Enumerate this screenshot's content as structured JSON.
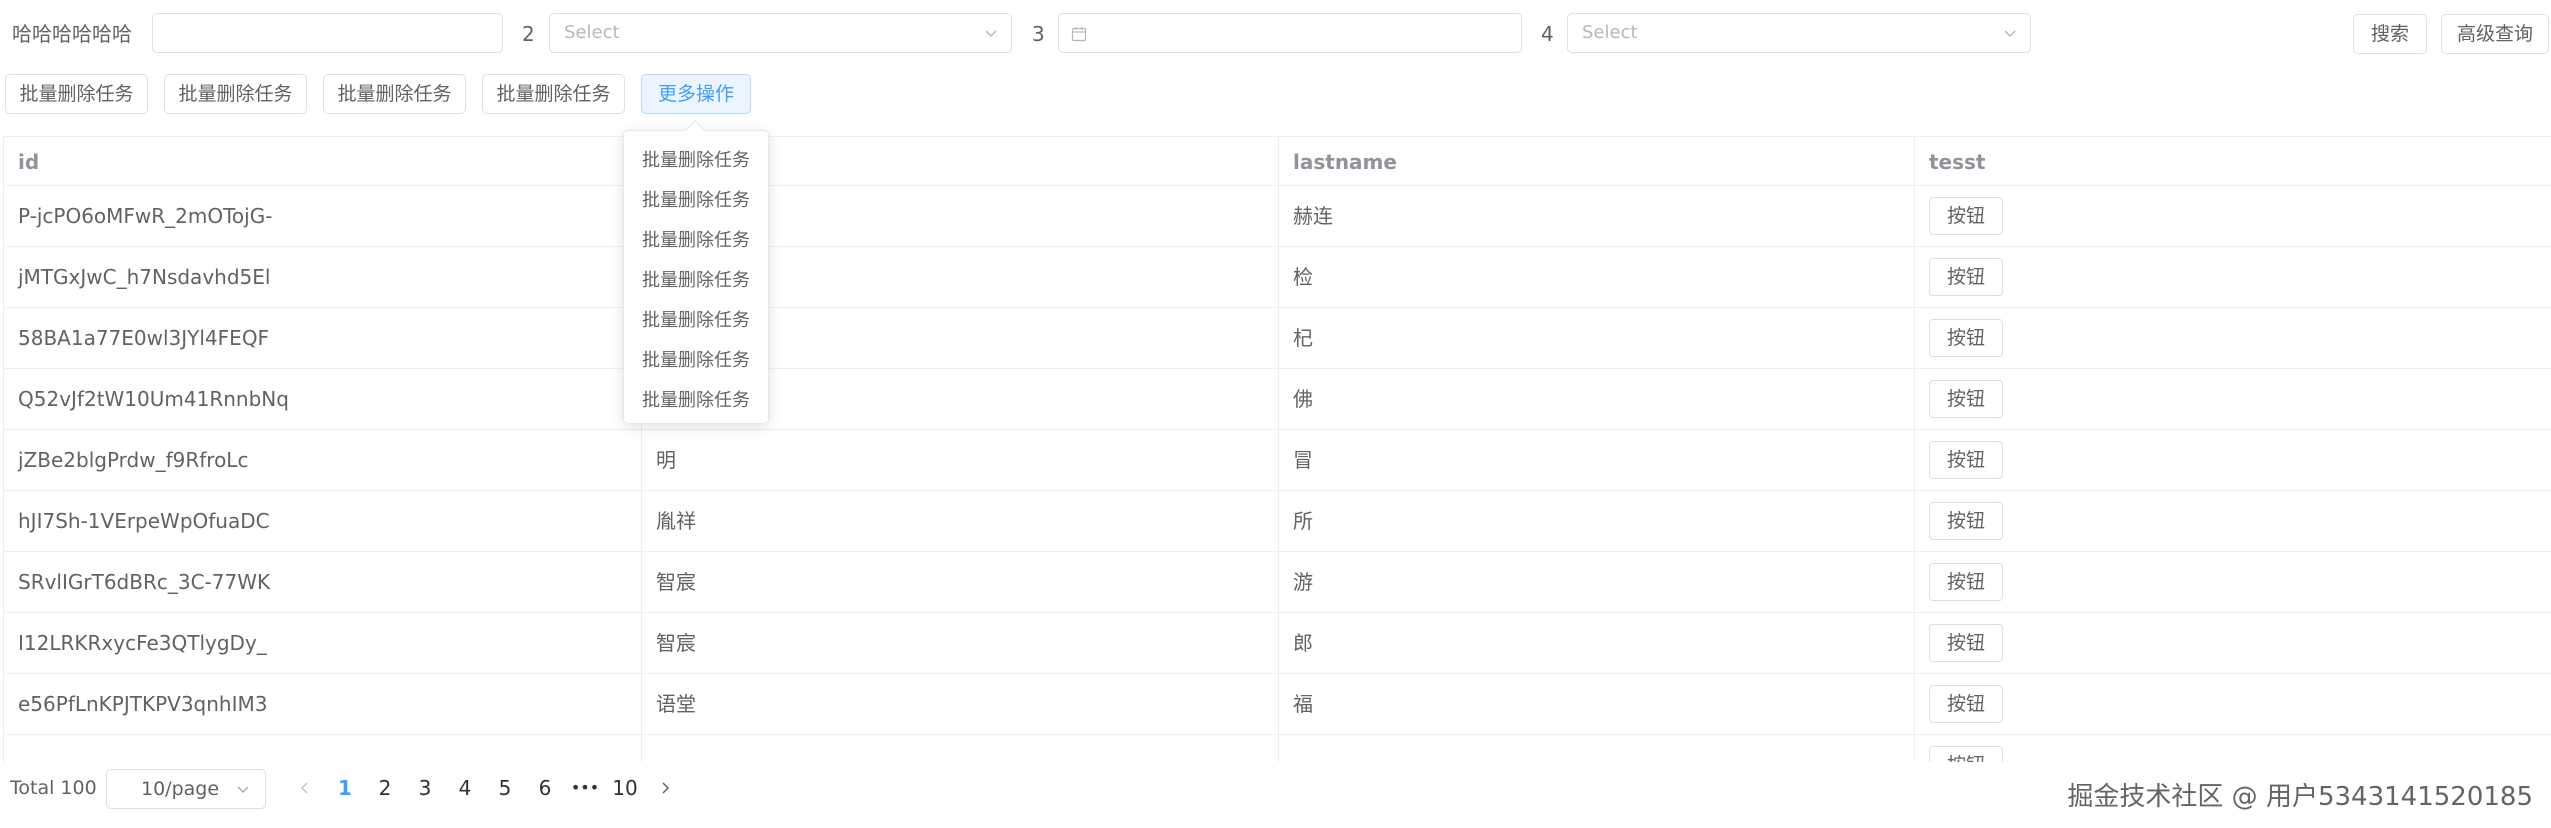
{
  "form": {
    "label1": "哈哈哈哈哈哈",
    "label2": "2",
    "label3": "3",
    "label4": "4",
    "select2_placeholder": "Select",
    "select4_placeholder": "Select",
    "search_button": "搜索",
    "advanced_button": "高级查询"
  },
  "batch": {
    "buttons": [
      "批量删除任务",
      "批量删除任务",
      "批量删除任务",
      "批量删除任务"
    ],
    "more_button": "更多操作"
  },
  "dropdown": {
    "items": [
      "批量删除任务",
      "批量删除任务",
      "批量删除任务",
      "批量删除任务",
      "批量删除任务",
      "批量删除任务",
      "批量删除任务"
    ]
  },
  "table": {
    "columns": [
      "id",
      "",
      "lastname",
      "tesst"
    ],
    "rows": [
      {
        "id": "P-jcPO6oMFwR_2mOTojG-",
        "firstname": "",
        "lastname": "赫连",
        "action": "按钮"
      },
      {
        "id": "jMTGxJwC_h7Nsdavhd5El",
        "firstname": "",
        "lastname": "检",
        "action": "按钮"
      },
      {
        "id": "58BA1a77E0wl3JYl4FEQF",
        "firstname": "",
        "lastname": "杞",
        "action": "按钮"
      },
      {
        "id": "Q52vJf2tW10Um41RnnbNq",
        "firstname": "",
        "lastname": "佛",
        "action": "按钮"
      },
      {
        "id": "jZBe2blgPrdw_f9RfroLc",
        "firstname": "明",
        "lastname": "冒",
        "action": "按钮"
      },
      {
        "id": "hJI7Sh-1VErpeWpOfuaDC",
        "firstname": "胤祥",
        "lastname": "所",
        "action": "按钮"
      },
      {
        "id": "SRvlIGrT6dBRc_3C-77WK",
        "firstname": "智宸",
        "lastname": "游",
        "action": "按钮"
      },
      {
        "id": "I12LRKRxycFe3QTlygDy_",
        "firstname": "智宸",
        "lastname": "郎",
        "action": "按钮"
      },
      {
        "id": "e56PfLnKPJTKPV3qnhIM3",
        "firstname": "语堂",
        "lastname": "福",
        "action": "按钮"
      },
      {
        "id": "",
        "firstname": "",
        "lastname": "",
        "action": "按钮"
      }
    ]
  },
  "pagination": {
    "total": "Total 100",
    "page_size": "10/page",
    "pages": [
      "1",
      "2",
      "3",
      "4",
      "5",
      "6",
      "•••",
      "10"
    ],
    "active_page": "1"
  },
  "watermark": "掘金技术社区 @ 用户5343141520185",
  "colors": {
    "primary": "#409eff",
    "border": "#dcdfe6",
    "text": "#606266",
    "header_text": "#909399"
  }
}
